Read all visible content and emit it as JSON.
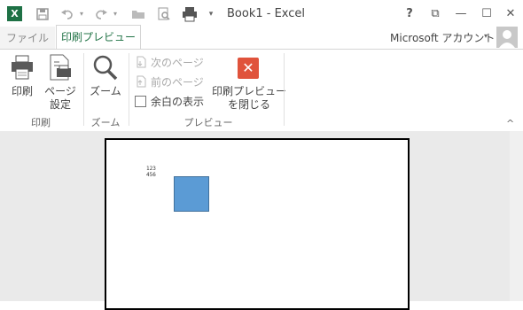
{
  "window": {
    "title": "Book1 - Excel",
    "controls": {
      "help": "?",
      "restore_ribbon": "⧉",
      "minimize": "—",
      "maximize": "☐",
      "close": "✕"
    }
  },
  "quick_access": {
    "icons": [
      "excel-logo-icon",
      "save-icon",
      "undo-icon",
      "redo-icon",
      "open-icon",
      "print-preview-icon",
      "print-icon",
      "customize-icon"
    ],
    "logo_letter": "X"
  },
  "tabs": [
    {
      "label": "ファイル",
      "active": false
    },
    {
      "label": "印刷プレビュー",
      "active": true
    }
  ],
  "account": {
    "label": "Microsoft アカウント"
  },
  "ribbon": {
    "groups": [
      {
        "name": "印刷",
        "buttons": [
          {
            "label": "印刷"
          },
          {
            "label_line1": "ページ",
            "label_line2": "設定"
          }
        ]
      },
      {
        "name": "ズーム",
        "buttons": [
          {
            "label": "ズーム"
          }
        ]
      },
      {
        "name": "プレビュー",
        "small_buttons": [
          {
            "label": "次のページ",
            "enabled": false
          },
          {
            "label": "前のページ",
            "enabled": false
          }
        ],
        "checkbox": {
          "label": "余白の表示",
          "checked": false
        },
        "close_button": {
          "label_line1": "印刷プレビュー",
          "label_line2": "を閉じる"
        }
      }
    ]
  },
  "preview": {
    "cells": [
      "123",
      "456"
    ]
  },
  "colors": {
    "accent": "#217346",
    "close_red": "#e0533c",
    "shape_fill": "#5b9bd5",
    "workspace_bg": "#eaeaea"
  }
}
